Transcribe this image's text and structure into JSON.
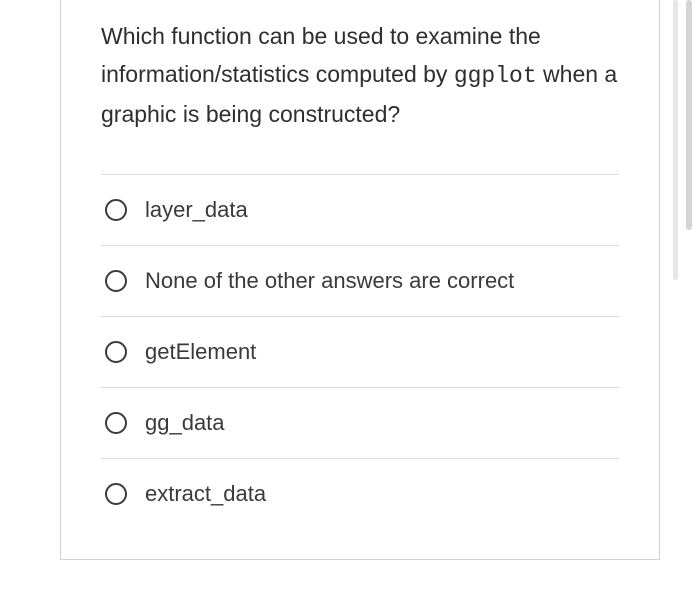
{
  "question": {
    "prefix": "Which function can be used to examine the information/statistics computed by ",
    "code_term": "ggplot",
    "suffix": " when a graphic is being constructed?"
  },
  "options": [
    {
      "label": "layer_data"
    },
    {
      "label": "None of the other answers are correct"
    },
    {
      "label": "getElement"
    },
    {
      "label": "gg_data"
    },
    {
      "label": "extract_data"
    }
  ]
}
